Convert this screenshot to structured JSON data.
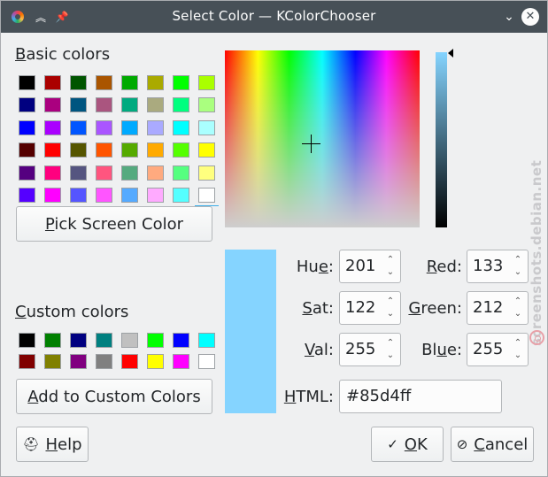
{
  "window": {
    "title": "Select Color — KColorChooser"
  },
  "basic_colors": {
    "label_accel": "B",
    "label_rest": "asic colors",
    "swatches": [
      "#000000",
      "#aa0000",
      "#005500",
      "#aa5500",
      "#00aa00",
      "#aaaa00",
      "#00ff00",
      "#aaff00",
      "#000080",
      "#aa007f",
      "#005580",
      "#aa557f",
      "#00aa7f",
      "#aaaa7f",
      "#00ff7f",
      "#aaff7f",
      "#0000ff",
      "#aa00ff",
      "#0055ff",
      "#aa55ff",
      "#00aaff",
      "#aaaaff",
      "#00ffff",
      "#aaffff",
      "#550000",
      "#ff0000",
      "#555500",
      "#ff5500",
      "#55aa00",
      "#ffaa00",
      "#55ff00",
      "#ffff00",
      "#550080",
      "#ff007f",
      "#555580",
      "#ff557f",
      "#55aa7f",
      "#ffaa7f",
      "#55ff7f",
      "#ffff7f",
      "#5500ff",
      "#ff00ff",
      "#5555ff",
      "#ff55ff",
      "#55aaff",
      "#ffaaff",
      "#55ffff",
      "#ffffff"
    ]
  },
  "pick_screen": {
    "accel": "P",
    "rest": "ick Screen Color"
  },
  "custom_colors": {
    "label_accel": "C",
    "label_rest": "ustom colors",
    "swatches": [
      "#000000",
      "#008000",
      "#000080",
      "#008080",
      "#c0c0c0",
      "#00ff00",
      "#0000ff",
      "#00ffff",
      "#800000",
      "#808000",
      "#800080",
      "#808080",
      "#ff0000",
      "#ffff00",
      "#ff00ff",
      "#ffffff"
    ]
  },
  "add_custom": {
    "accel": "A",
    "rest": "dd to Custom Colors"
  },
  "current_color": "#85d4ff",
  "fields": {
    "hue": {
      "label_pre": "Hu",
      "label_accel": "e",
      "label_post": ":",
      "value": "201"
    },
    "sat": {
      "label_pre": "",
      "label_accel": "S",
      "label_post": "at:",
      "value": "122"
    },
    "val": {
      "label_pre": "",
      "label_accel": "V",
      "label_post": "al:",
      "value": "255"
    },
    "red": {
      "label_pre": "",
      "label_accel": "R",
      "label_post": "ed:",
      "value": "133"
    },
    "green": {
      "label_pre": "",
      "label_accel": "G",
      "label_post": "reen:",
      "value": "212"
    },
    "blue": {
      "label_pre": "Bl",
      "label_accel": "u",
      "label_post": "e:",
      "value": "255"
    }
  },
  "html_field": {
    "label_accel": "H",
    "label_rest": "TML:",
    "value": "#85d4ff"
  },
  "help_button": {
    "label_pre": "",
    "label_accel": "H",
    "label_post": "elp",
    "icon": "lifebuoy-icon"
  },
  "ok_button": {
    "label_pre": "",
    "label_accel": "O",
    "label_post": "K",
    "icon": "checkmark-icon"
  },
  "cancel_button": {
    "label_pre": "",
    "label_accel": "C",
    "label_post": "ancel",
    "icon": "cancel-icon"
  },
  "watermark": "screenshots.debian.net"
}
